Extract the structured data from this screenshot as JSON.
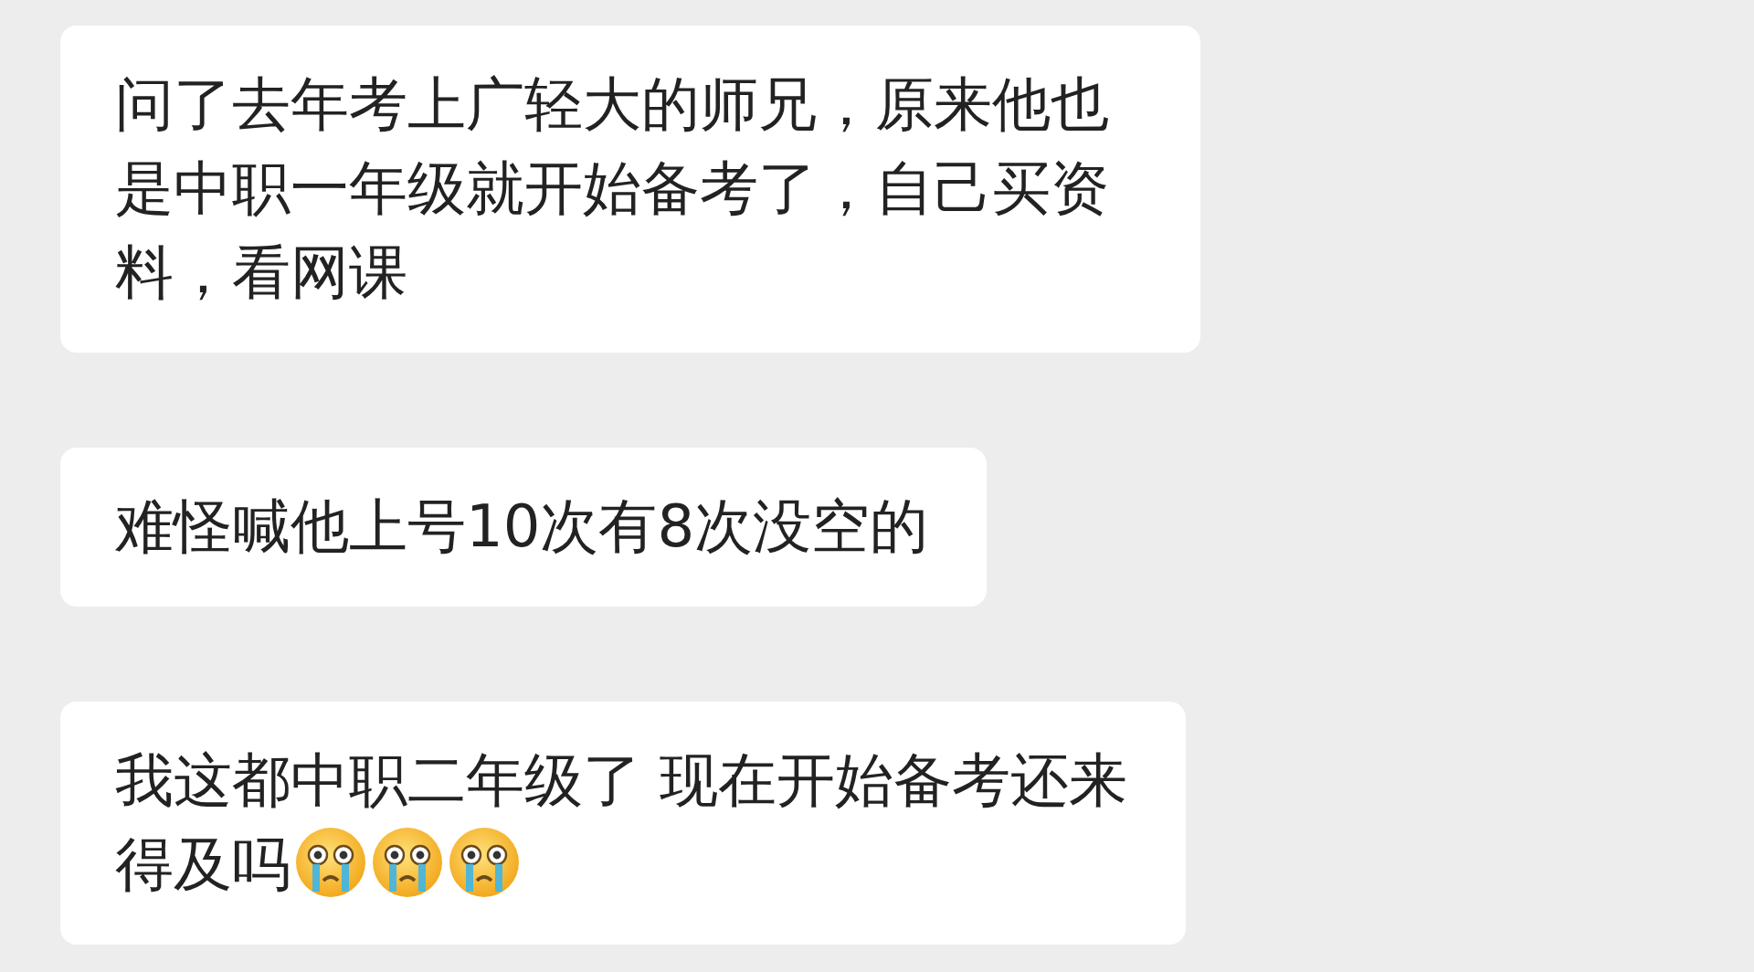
{
  "messages": [
    {
      "lines": [
        "问了去年考上广轻大的师兄，原来他也是中职一年级就开始备考了，自己买资料，看网课"
      ]
    },
    {
      "lines": [
        "难怪喊他上号10次有8次没空的"
      ]
    },
    {
      "lines": [
        "我这都中职二年级了 现在开始备考还来",
        "得及吗"
      ],
      "emojis": [
        {
          "kind": "crying"
        },
        {
          "kind": "crying"
        },
        {
          "kind": "crying"
        }
      ]
    }
  ]
}
